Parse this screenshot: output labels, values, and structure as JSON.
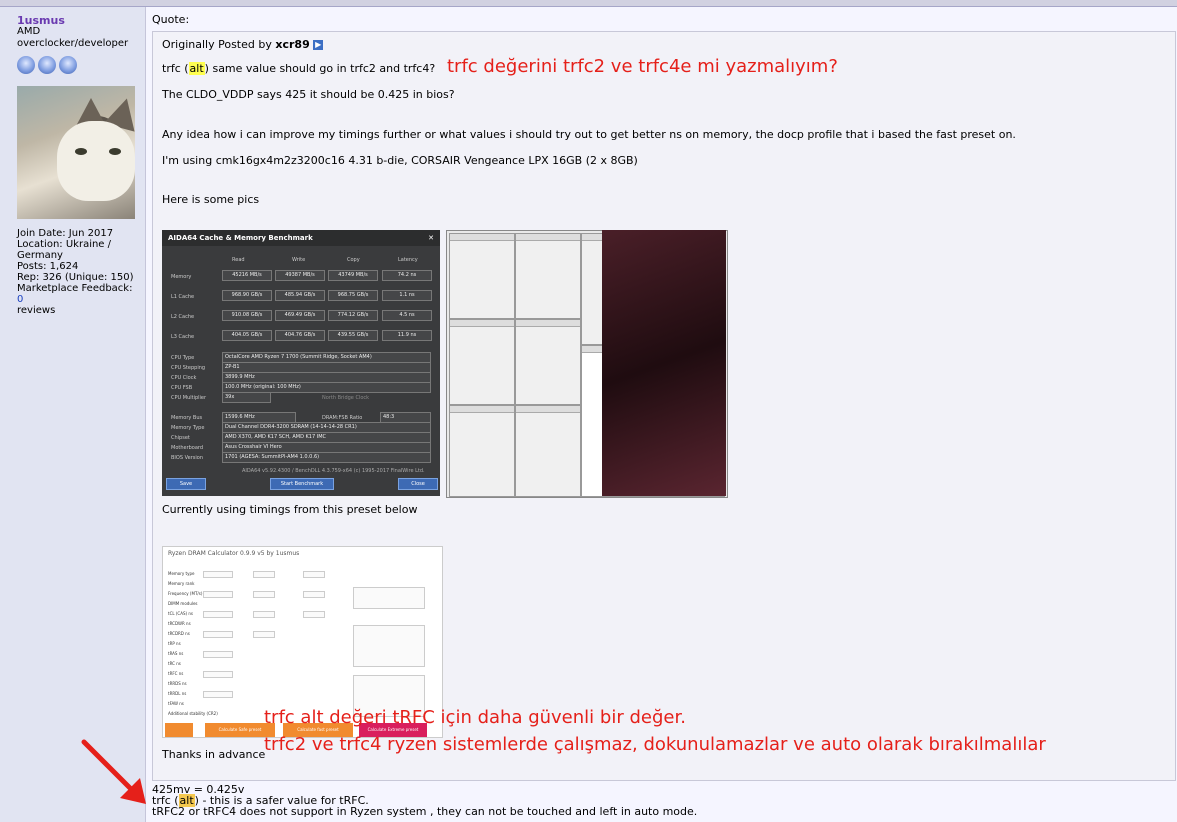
{
  "sidebar": {
    "username": "1usmus",
    "title_line1": "AMD",
    "title_line2": "overclocker/developer",
    "join_date": "Join Date: Jun 2017",
    "location": "Location: Ukraine / Germany",
    "posts": "Posts: 1,624",
    "rep": "Rep: 326 (Unique: 150)",
    "marketplace_label": "Marketplace Feedback:",
    "marketplace_value": "0",
    "marketplace_suffix": "reviews"
  },
  "post": {
    "quote_label": "Quote:",
    "originally_posted_by": "Originally Posted by",
    "quote_author": "xcr89",
    "q_line1_pre": "trfc (",
    "q_line1_hl": "alt",
    "q_line1_post": ") same value should go in trfc2 and trfc4?",
    "q_line2": "The CLDO_VDDP says 425 it should be 0.425 in bios?",
    "q_line3": "Any idea how i can improve my timings further or what values i should try out to get better ns on memory, the docp profile that i based the fast preset on.",
    "q_line4": "I'm using cmk16gx4m2z3200c16 4.31 b-die, CORSAIR Vengeance LPX 16GB (2 x 8GB)",
    "q_line5": "Here is some pics",
    "q_line6": "Currently using timings from this preset below",
    "q_line7": "Thanks in advance",
    "reply1": "425mv = 0.425v",
    "reply2_pre": "trfc (",
    "reply2_hl": "alt",
    "reply2_post": ") - this is a safer value for tRFC.",
    "reply3": "tRFC2 or tRFC4 does not support in Ryzen system , they can not be touched and left in auto mode."
  },
  "annotations": {
    "turk1": "trfc değerini trfc2 ve trfc4e mi yazmalıyım?",
    "turk2": "trfc alt değeri tRFC için daha güvenli bir değer.",
    "turk3": "trfc2 ve trfc4 ryzen sistemlerde çalışmaz, dokunulamazlar ve auto olarak bırakılmalılar",
    "color": "#e5201a"
  },
  "aida": {
    "title": "AIDA64 Cache & Memory Benchmark",
    "cols": [
      "Read",
      "Write",
      "Copy",
      "Latency"
    ],
    "rows": [
      {
        "label": "Memory",
        "vals": [
          "45216 MB/s",
          "49387 MB/s",
          "43749 MB/s",
          "74.2 ns"
        ]
      },
      {
        "label": "L1 Cache",
        "vals": [
          "968.90 GB/s",
          "485.94 GB/s",
          "968.75 GB/s",
          "1.1 ns"
        ]
      },
      {
        "label": "L2 Cache",
        "vals": [
          "910.08 GB/s",
          "469.49 GB/s",
          "774.12 GB/s",
          "4.5 ns"
        ]
      },
      {
        "label": "L3 Cache",
        "vals": [
          "404.05 GB/s",
          "404.76 GB/s",
          "439.55 GB/s",
          "11.9 ns"
        ]
      }
    ],
    "cpu_type": "OctalCore AMD Ryzen 7 1700 (Summit Ridge, Socket AM4)",
    "cpu_stepping": "ZP-B1",
    "cpu_clock": "3899.9 MHz",
    "cpu_fsb": "100.0 MHz (original: 100 MHz)",
    "cpu_multiplier": "39x",
    "memory_bus": "1599.6 MHz",
    "dram_ratio": "48:3",
    "memory_type": "Dual Channel DDR4-3200 SDRAM (14-14-14-28 CR1)",
    "chipset": "AMD X370, AMD K17 SCH, AMD K17 IMC",
    "motherboard": "Asus Crosshair VI Hero",
    "bios": "1701 (AGESA: SummitPI-AM4 1.0.0.6)",
    "footer": "AIDA64 v5.92.4300 / BenchDLL 4.3.759-x64 (c) 1995-2017 FinalWire Ltd.",
    "btn_save": "Save",
    "btn_start": "Start Benchmark",
    "btn_close": "Close"
  },
  "calc": {
    "title": "Ryzen DRAM Calculator 0.9.9 v5 by 1usmus",
    "btn1": "Calculate Safe preset",
    "btn2": "Calculate fast preset",
    "btn3": "Calculate Extreme preset"
  }
}
